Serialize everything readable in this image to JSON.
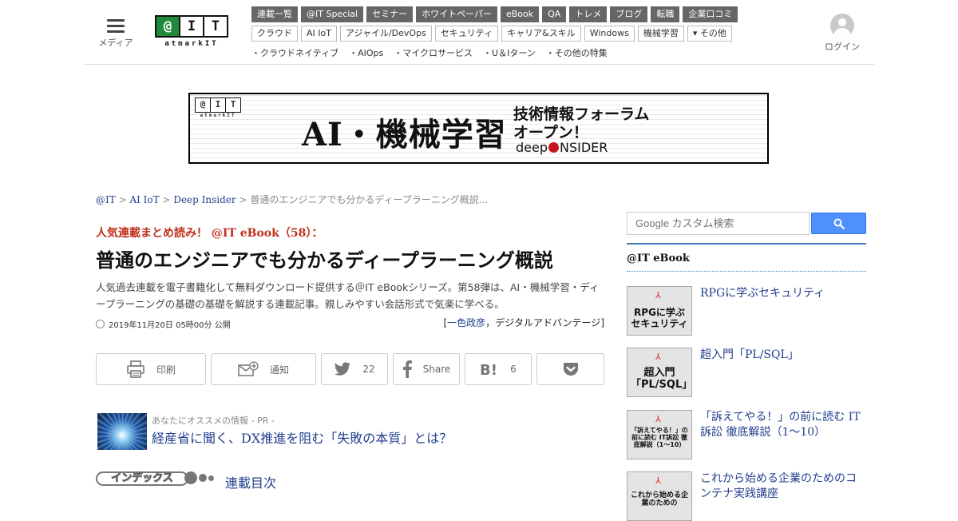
{
  "header": {
    "menu_label": "メディア",
    "logo": {
      "chars": [
        "@",
        "I",
        "T"
      ],
      "sub": "atmarkIT"
    },
    "nav_primary": [
      "連載一覧",
      "@IT Special",
      "セミナー",
      "ホワイトペーパー",
      "eBook",
      "QA",
      "トレメ",
      "ブログ",
      "転職",
      "企業口コミ"
    ],
    "nav_secondary": [
      "クラウド",
      "AI IoT",
      "アジャイル/DevOps",
      "セキュリティ",
      "キャリア&スキル",
      "Windows",
      "機械学習",
      "▾ その他"
    ],
    "nav_features": [
      "・クラウドネイティブ",
      "・AIOps",
      "・マイクロサービス",
      "・U＆Iターン",
      "・その他の特集"
    ],
    "login_label": "ログイン"
  },
  "banner": {
    "logo_chars": [
      "@",
      "I",
      "T"
    ],
    "logo_sub": "atmarkIT",
    "title": "AI・機械学習",
    "forum_line1": "技術情報フォーラム",
    "forum_line2": "オープン！",
    "brand_left": "deep",
    "brand_right": "NSIDER"
  },
  "breadcrumb": {
    "items": [
      "@IT",
      "AI IoT",
      "Deep Insider"
    ],
    "current": "普通のエンジニアでも分かるディープラーニング概説..."
  },
  "article": {
    "kicker": "人気連載まとめ読み！ @IT eBook（58）：",
    "title": "普通のエンジニアでも分かるディープラーニング概説",
    "lead": "人気過去連載を電子書籍化して無料ダウンロード提供する＠IT eBookシリーズ。第58弾は、AI・機械学習・ディープラーニングの基礎の基礎を解説する連載記事。親しみやすい会話形式で気楽に学べる。",
    "date": "2019年11月20日 05時00分 公開",
    "author": "一色政彦",
    "publisher": "デジタルアドバンテージ"
  },
  "share": {
    "print_label": "印刷",
    "notify_label": "通知",
    "twitter_count": "22",
    "facebook_label": "Share",
    "hatena_count": "6"
  },
  "pr": {
    "label": "あなたにオススメの情報 - PR -",
    "link": "経産省に聞く、DX推進を阻む「失敗の本質」とは？"
  },
  "index": {
    "badge": "インデックス",
    "link": "連載目次"
  },
  "sidebar": {
    "search_placeholder": "Google カスタム検索",
    "heading": "@IT eBook",
    "items": [
      {
        "thumb_title": "RPGに学ぶセキュリティ",
        "title": "RPGに学ぶセキュリティ"
      },
      {
        "thumb_title": "超入門「PL/SQL」",
        "title": "超入門「PL/SQL」"
      },
      {
        "thumb_title": "「訴えてやる！」の前に読む IT訴訟 徹底解説（1〜10）",
        "title": "「訴えてやる！」の前に読む IT訴訟 徹底解説（1～10）"
      },
      {
        "thumb_title": "これから始める企業のための",
        "title": "これから始める企業のためのコンテナ実践講座"
      }
    ]
  },
  "colors": {
    "link": "#23408e",
    "kicker": "#c0311d",
    "nav_bg": "#666666",
    "search_button": "#4d90fe",
    "sidebar_rule": "#3e7bb5"
  }
}
